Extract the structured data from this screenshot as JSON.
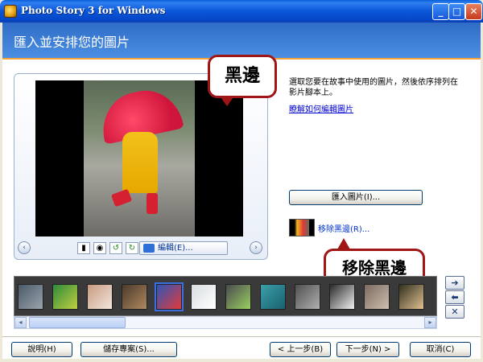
{
  "window": {
    "title": "Photo Story 3 for Windows",
    "minimize_glyph": "_",
    "maximize_glyph": "□",
    "close_glyph": "✕"
  },
  "header": {
    "title": "匯入並安排您的圖片"
  },
  "preview": {
    "prev_glyph": "‹",
    "next_glyph": "›",
    "edit_label": "編輯(E)..."
  },
  "right_panel": {
    "instruction": "選取您要在故事中使用的圖片，然後依序排列在影片腳本上。",
    "learn_link": "瞭解如何編輯圖片",
    "import_label": "匯入圖片(I)...",
    "remove_black_label": "移除黑邊(R)..."
  },
  "callouts": {
    "black_border": "黑邊",
    "remove_black_border": "移除黑邊"
  },
  "filmstrip": {
    "thumbnails": [
      {
        "colors": [
          "#4a5a6a",
          "#9aa4ab"
        ]
      },
      {
        "colors": [
          "#2f8a3c",
          "#c0d040"
        ]
      },
      {
        "colors": [
          "#c89a80",
          "#f1e6dc"
        ]
      },
      {
        "colors": [
          "#4a3a2a",
          "#b08860"
        ]
      },
      {
        "colors": [
          "#2c56b8",
          "#e23a3a"
        ],
        "selected": true
      },
      {
        "colors": [
          "#d8dde0",
          "#ffffff"
        ]
      },
      {
        "colors": [
          "#4a4a50",
          "#9ad060"
        ]
      },
      {
        "colors": [
          "#3aa0a8",
          "#1a6070"
        ]
      },
      {
        "colors": [
          "#505050",
          "#b0b0b0"
        ]
      },
      {
        "colors": [
          "#2a2a2a",
          "#f0f0f0"
        ]
      },
      {
        "colors": [
          "#7a6a60",
          "#d0c0b0"
        ]
      },
      {
        "colors": [
          "#30301e",
          "#e0c090"
        ]
      }
    ],
    "scroll_left": "◂",
    "scroll_right": "▸"
  },
  "side_buttons": {
    "move_right": "➔",
    "move_left": "⬅",
    "delete": "✕"
  },
  "footer": {
    "help_label": "說明(H)",
    "save_label": "儲存專案(S)...",
    "back_label": "< 上一步(B)",
    "next_label": "下一步(N) >",
    "cancel_label": "取消(C)"
  }
}
